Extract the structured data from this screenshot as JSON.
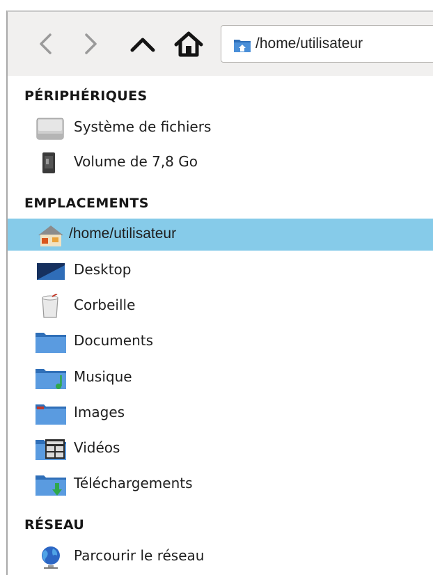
{
  "toolbar": {
    "back_icon": "chevron-left-icon",
    "forward_icon": "chevron-right-icon",
    "up_icon": "chevron-up-icon",
    "home_icon": "home-icon"
  },
  "pathbar": {
    "icon": "folder-home-icon",
    "path": "/home/utilisateur"
  },
  "sidebar": {
    "sections": [
      {
        "title": "PÉRIPHÉRIQUES",
        "items": [
          {
            "label": "Système de fichiers",
            "icon": "hard-drive-icon"
          },
          {
            "label": "Volume de 7,8 Go",
            "icon": "flash-drive-icon"
          }
        ]
      },
      {
        "title": "EMPLACEMENTS",
        "items": [
          {
            "label": "/home/utilisateur",
            "icon": "home-folder-icon",
            "selected": true
          },
          {
            "label": "Desktop",
            "icon": "desktop-icon"
          },
          {
            "label": "Corbeille",
            "icon": "trash-icon"
          },
          {
            "label": "Documents",
            "icon": "documents-folder-icon"
          },
          {
            "label": "Musique",
            "icon": "music-folder-icon"
          },
          {
            "label": "Images",
            "icon": "pictures-folder-icon"
          },
          {
            "label": "Vidéos",
            "icon": "videos-folder-icon"
          },
          {
            "label": "Téléchargements",
            "icon": "downloads-folder-icon"
          }
        ]
      },
      {
        "title": "RÉSEAU",
        "items": [
          {
            "label": "Parcourir le réseau",
            "icon": "network-globe-icon"
          }
        ]
      }
    ]
  },
  "colors": {
    "selection": "#86cbe9",
    "toolbar_bg": "#f1f0ef",
    "folder_blue": "#3f7cc6"
  }
}
